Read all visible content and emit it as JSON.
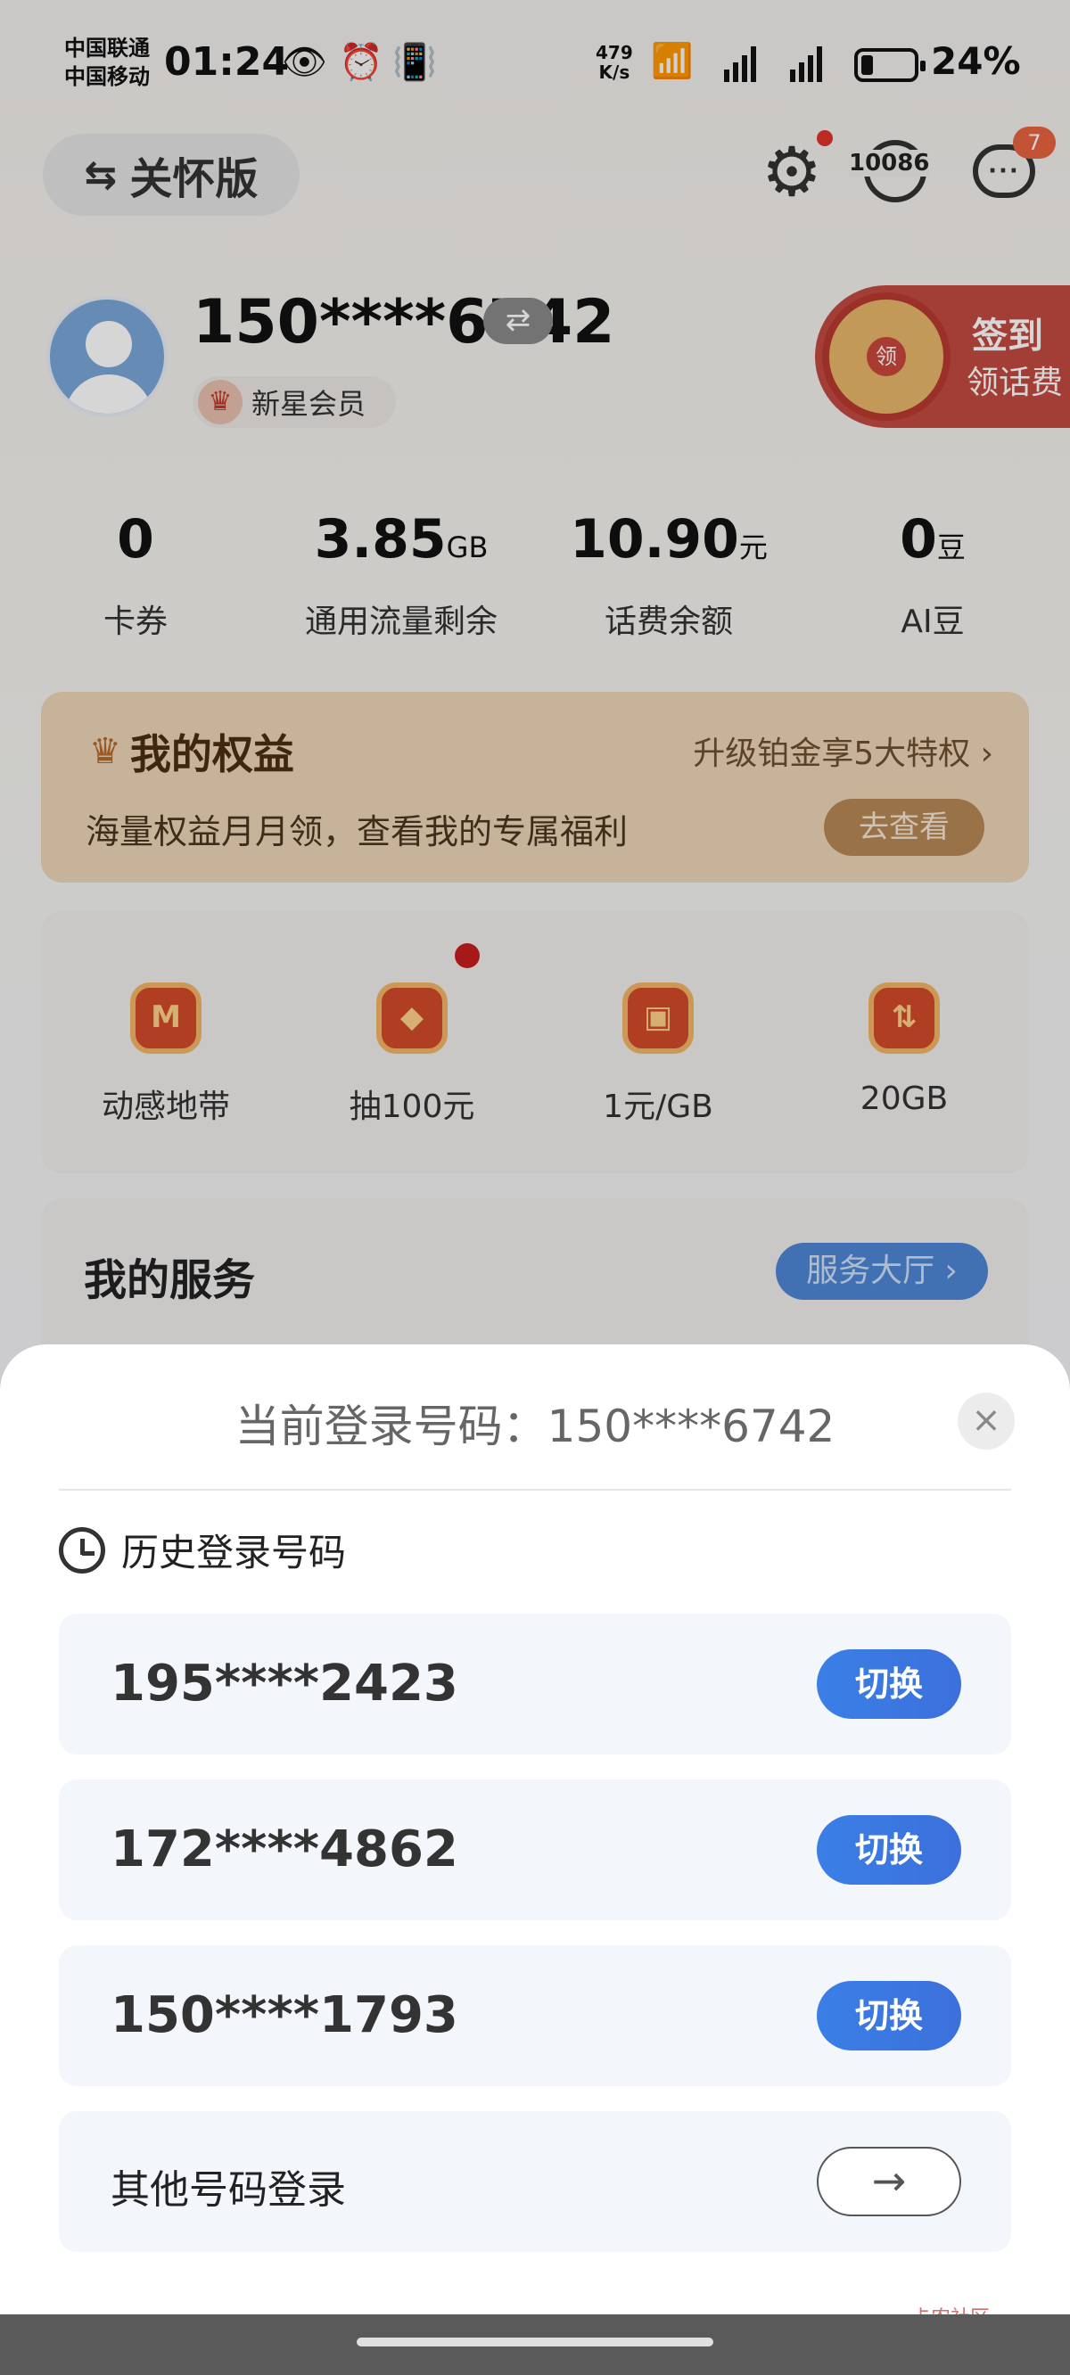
{
  "status_bar": {
    "carrier_1": "中国联通",
    "carrier_2": "中国移动",
    "time": "01:24",
    "net_speed_value": "479",
    "net_speed_unit": "K/s",
    "battery": "24%",
    "battery_level": 0.24
  },
  "header": {
    "care_mode_label": "关怀版",
    "service_hotline": "10086",
    "message_badge": "7",
    "message_icon": "chat-bubble-icon",
    "settings_icon": "gear-icon"
  },
  "profile": {
    "phone": "150****6742",
    "member_level": "新星会员",
    "signin_line1": "签到",
    "signin_line2": "领话费",
    "signin_wheel_label": "领"
  },
  "stats": [
    {
      "value": "0",
      "unit": "",
      "label": "卡券"
    },
    {
      "value": "3.85",
      "unit": "GB",
      "label": "通用流量剩余"
    },
    {
      "value": "10.90",
      "unit": "元",
      "label": "话费余额"
    },
    {
      "value": "0",
      "unit": "豆",
      "label": "AI豆"
    }
  ],
  "rights": {
    "title": "我的权益",
    "upgrade": "升级铂金享5大特权 ›",
    "desc": "海量权益月月领，查看我的专属福利",
    "go_label": "去查看"
  },
  "quick": [
    {
      "label": "动感地带",
      "icon_text": "M"
    },
    {
      "label": "抽100元",
      "icon_text": "◆"
    },
    {
      "label": "1元/GB",
      "icon_text": "▣"
    },
    {
      "label": "20GB",
      "icon_text": "⇅"
    }
  ],
  "service": {
    "title": "我的服务",
    "hall_label": "服务大厅 ›"
  },
  "sheet": {
    "current_login": "当前登录号码：150****6742",
    "history_title": "历史登录号码",
    "accounts": [
      {
        "number": "195****2423",
        "action": "切换"
      },
      {
        "number": "172****4862",
        "action": "切换"
      },
      {
        "number": "150****1793",
        "action": "切换"
      }
    ],
    "other_login": "其他号码登录",
    "other_arrow": "→",
    "close": "×"
  },
  "watermark": "卡农社区"
}
